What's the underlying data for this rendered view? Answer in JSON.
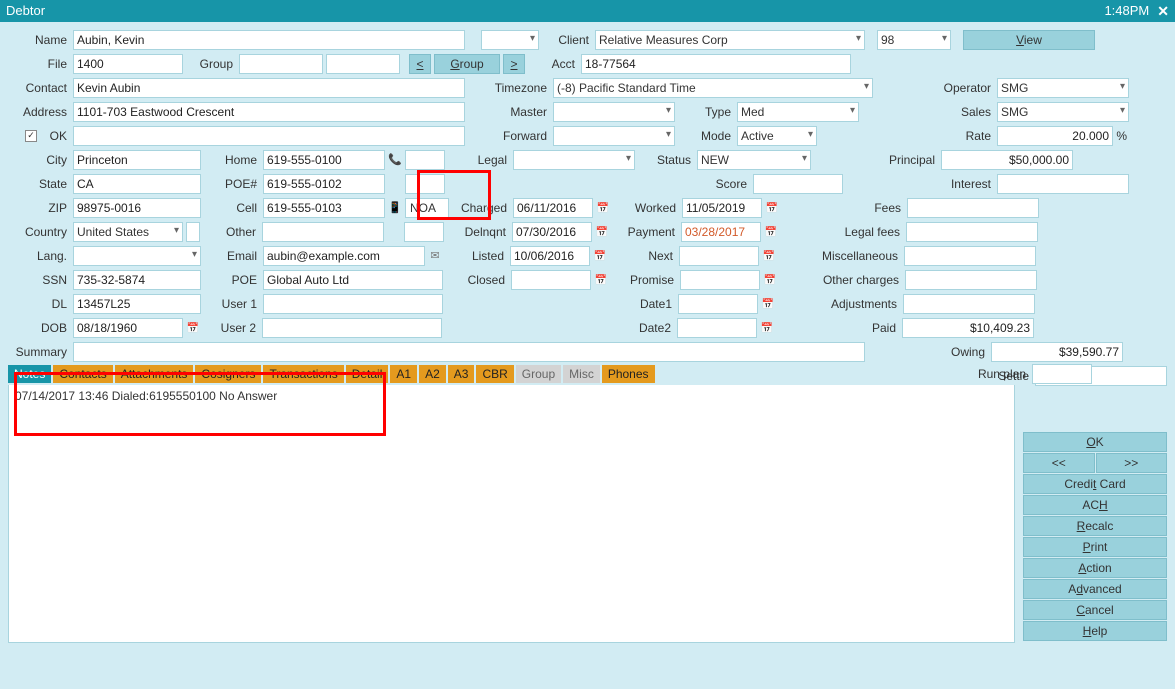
{
  "titlebar": {
    "title": "Debtor",
    "time": "1:48PM"
  },
  "labels": {
    "name": "Name",
    "file": "File",
    "group": "Group",
    "contact": "Contact",
    "address": "Address",
    "ok": "OK",
    "city": "City",
    "state": "State",
    "zip": "ZIP",
    "country": "Country",
    "lang": "Lang.",
    "ssn": "SSN",
    "dl": "DL",
    "dob": "DOB",
    "summary": "Summary",
    "home": "Home",
    "poeNum": "POE#",
    "cell": "Cell",
    "other": "Other",
    "email": "Email",
    "poe": "POE",
    "user1": "User 1",
    "user2": "User 2",
    "client": "Client",
    "acct": "Acct",
    "timezone": "Timezone",
    "master": "Master",
    "forward": "Forward",
    "legal": "Legal",
    "noa": "NOA",
    "charged": "Charged",
    "delnqnt": "Delnqnt",
    "listed": "Listed",
    "closed": "Closed",
    "type": "Type",
    "mode": "Mode",
    "status": "Status",
    "score": "Score",
    "worked": "Worked",
    "payment": "Payment",
    "next": "Next",
    "promise": "Promise",
    "date1": "Date1",
    "date2": "Date2",
    "operator": "Operator",
    "sales": "Sales",
    "rate": "Rate",
    "principal": "Principal",
    "interest": "Interest",
    "fees": "Fees",
    "legalFees": "Legal fees",
    "miscellaneous": "Miscellaneous",
    "otherCharges": "Other charges",
    "adjustments": "Adjustments",
    "paid": "Paid",
    "owing": "Owing",
    "settle": "Settle",
    "runPlan": "Run plan",
    "percent": "%"
  },
  "nav": {
    "prev": "<",
    "groupBtn": "Group",
    "next": ">"
  },
  "buttons": {
    "view": "View",
    "ok": "OK",
    "prev": "<<",
    "next": ">>",
    "creditCard": "Credit Card",
    "ach": "ACH",
    "recalc": "Recalc",
    "print": "Print",
    "action": "Action",
    "advanced": "Advanced",
    "cancel": "Cancel",
    "help": "Help"
  },
  "tabs": {
    "notes": "Notes",
    "contacts": "Contacts",
    "attachments": "Attachments",
    "cosigners": "Cosigners",
    "transactions": "Transactions",
    "detail": "Detail",
    "a1": "A1",
    "a2": "A2",
    "a3": "A3",
    "cbr": "CBR",
    "group": "Group",
    "misc": "Misc",
    "phones": "Phones"
  },
  "values": {
    "name": "Aubin, Kevin",
    "file": "1400",
    "group": "",
    "contact": "Kevin Aubin",
    "address": "1101-703 Eastwood Crescent",
    "okChecked": "✓",
    "address2": "",
    "city": "Princeton",
    "state": "CA",
    "zip": "98975-0016",
    "country": "United States",
    "lang": "",
    "ssn": "735-32-5874",
    "dl": "13457L25",
    "dob": "08/18/1960",
    "home": "619-555-0100",
    "poeNum": "619-555-0102",
    "cell": "619-555-0103",
    "other": "",
    "email": "aubin@example.com",
    "poe": "Global Auto Ltd",
    "user1": "",
    "user2": "",
    "client": "Relative Measures Corp",
    "clientNum": "98",
    "acct": "18-77564",
    "timezone": "(-8) Pacific Standard Time",
    "master": "",
    "forward": "",
    "legal": "",
    "noa": "NOA",
    "charged": "06/11/2016",
    "delnqnt": "07/30/2016",
    "listed": "10/06/2016",
    "closed": "",
    "type": "Med",
    "mode": "Active",
    "status": "NEW",
    "score": "",
    "worked": "11/05/2019",
    "payment": "03/28/2017",
    "next": "",
    "promise": "",
    "date1": "",
    "date2": "",
    "operator": "SMG",
    "sales": "SMG",
    "rate": "20.000",
    "principal": "$50,000.00",
    "interest": "",
    "fees": "",
    "legalFees": "",
    "miscellaneous": "",
    "otherCharges": "",
    "adjustments": "",
    "paid": "$10,409.23",
    "owing": "$39,590.77",
    "settle": "",
    "runPlan": "",
    "summary": ""
  },
  "notesEntry": "07/14/2017 13:46 Dialed:6195550100 No Answer"
}
